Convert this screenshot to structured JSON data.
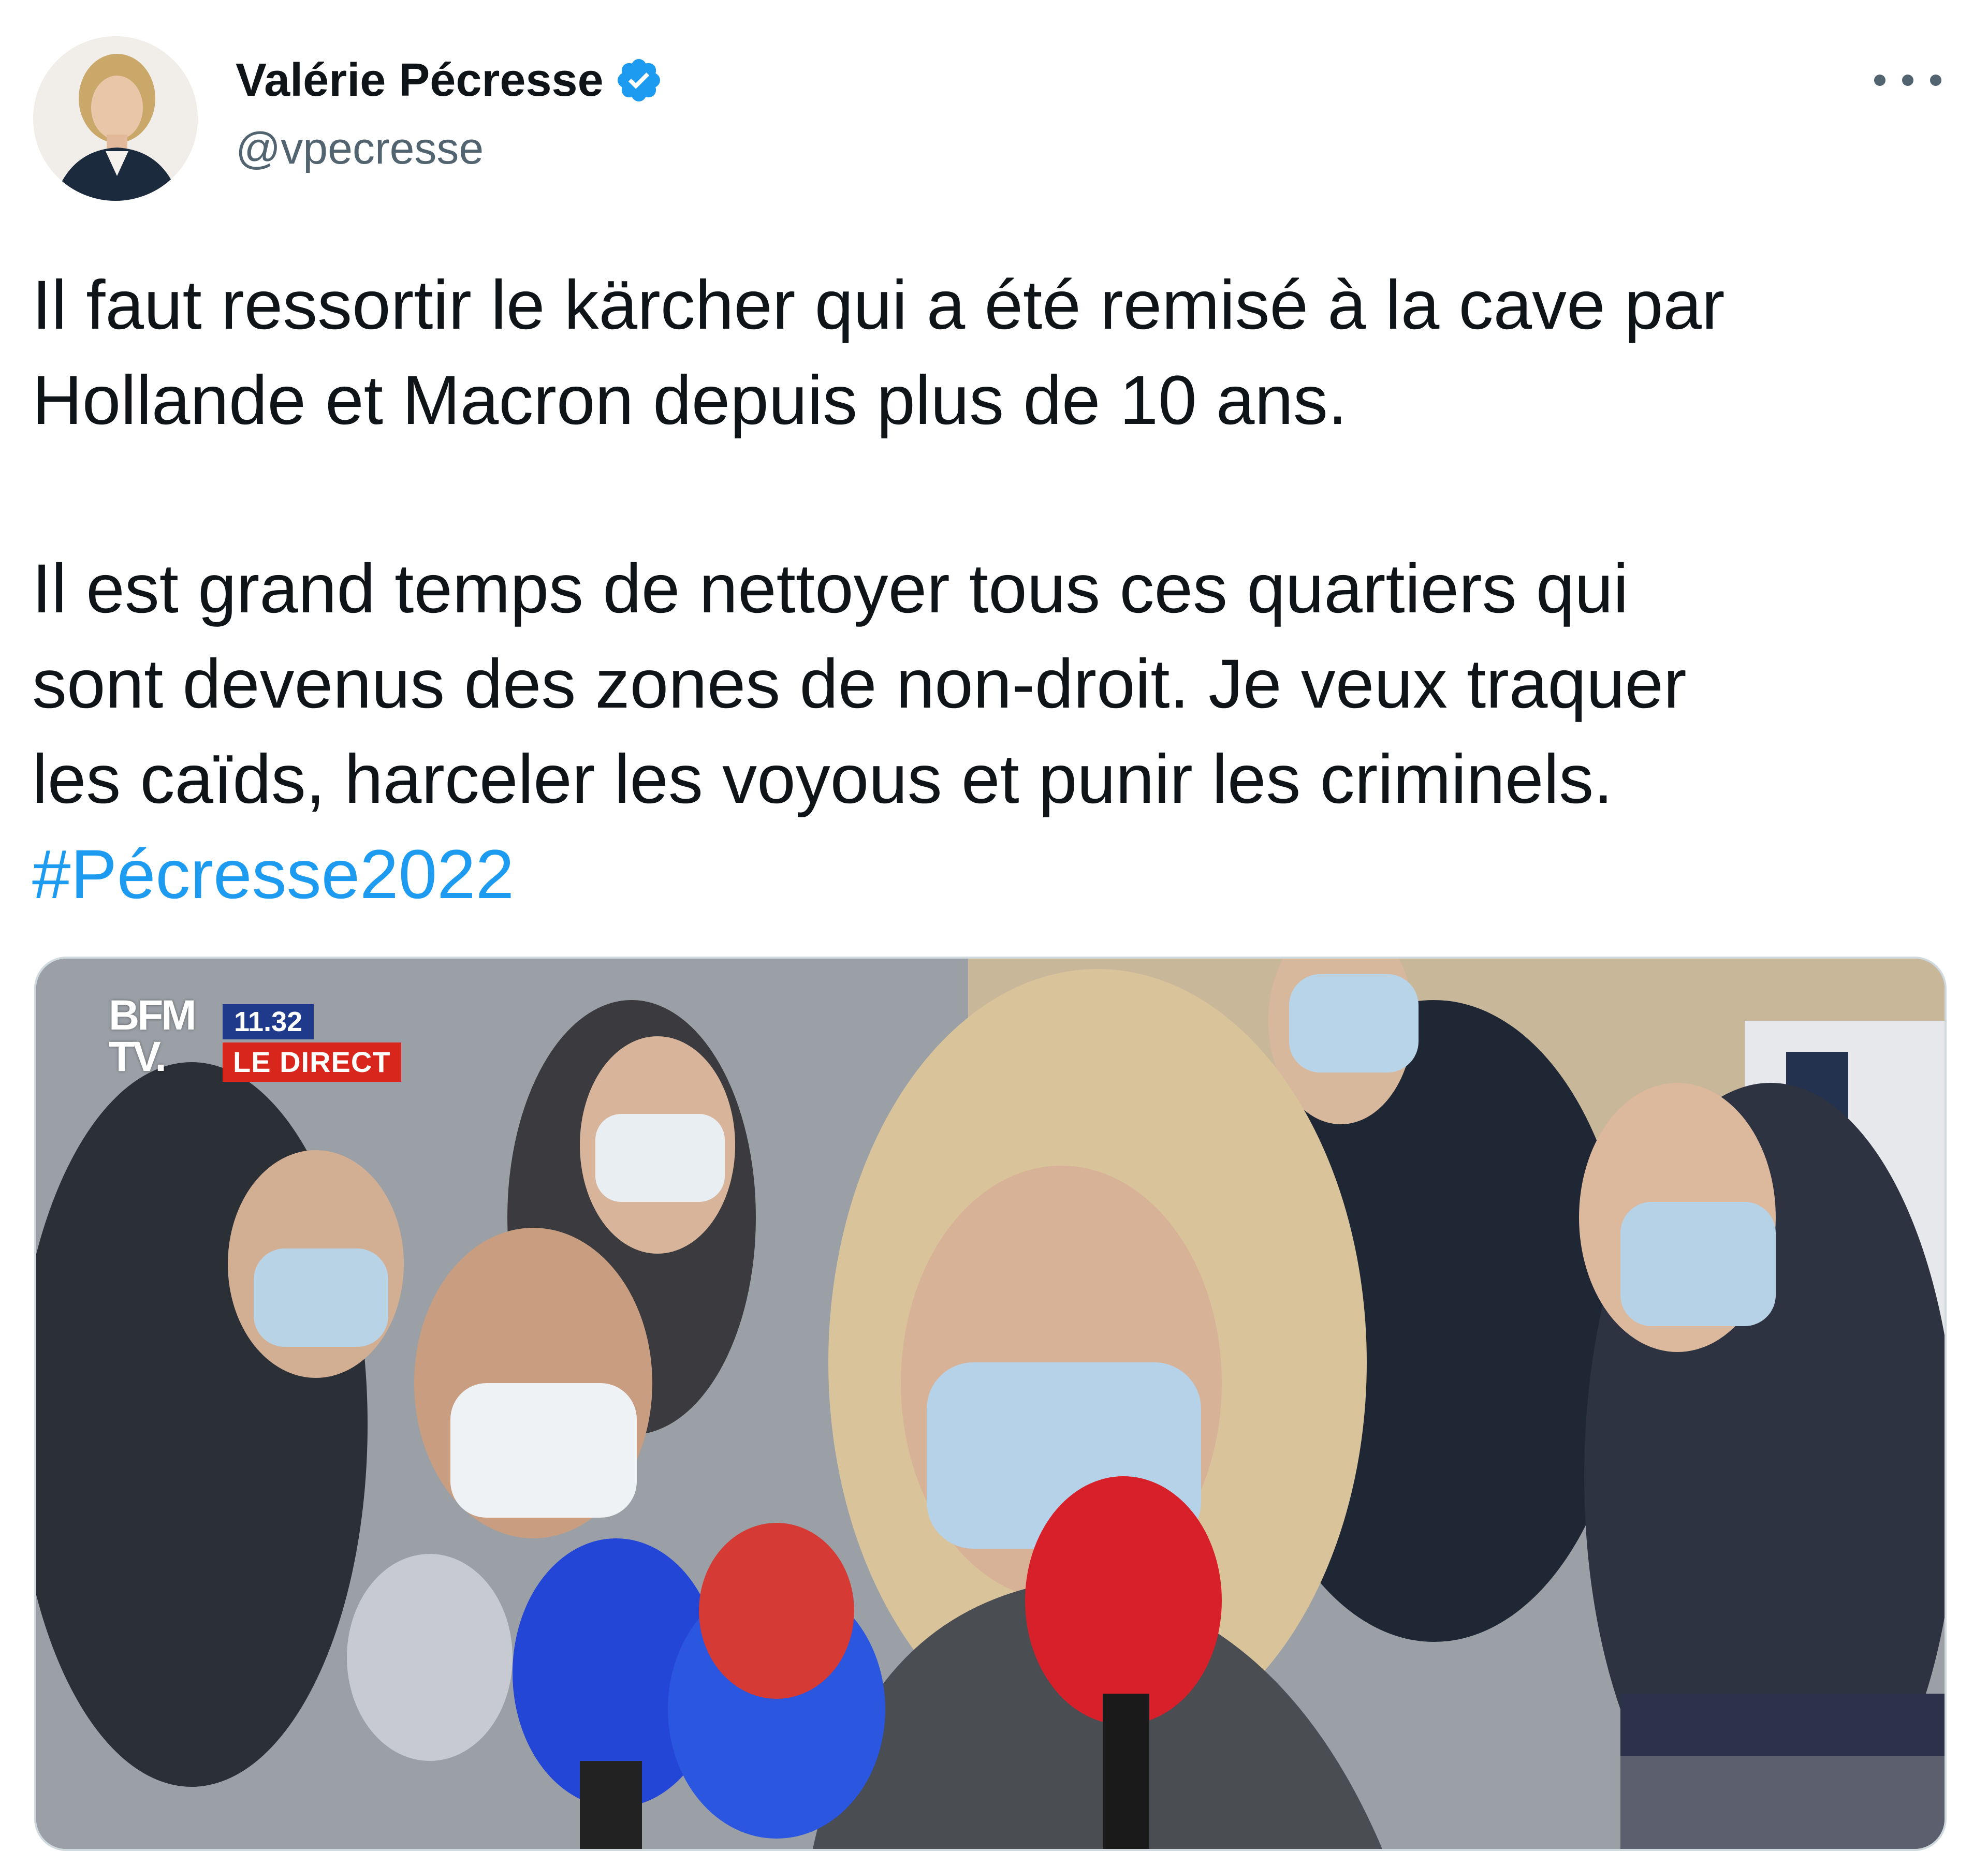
{
  "author": {
    "display_name": "Valérie Pécresse",
    "handle": "@vpecresse",
    "verified": true
  },
  "tweet": {
    "paragraph_1": "Il faut ressortir le kärcher qui a été remisé à la cave par\nHollande et Macron depuis plus de 10 ans.",
    "paragraph_2": "Il est grand temps de nettoyer tous ces quartiers qui\nsont devenus des zones de non-droit. Je veux traquer\nles caïds, harceler les voyous et punir les criminels.",
    "hashtag": "#Pécresse2022"
  },
  "media": {
    "type": "video",
    "overlay": {
      "channel": "BFM\nTV.",
      "time": "11.32",
      "live_label": "LE DIRECT"
    }
  },
  "colors": {
    "link": "#1d9bf0",
    "text": "#0f1419",
    "secondary": "#536471",
    "border": "#cfd9de",
    "verified": "#1d9bf0",
    "live_red": "#d9261c",
    "bfm_blue": "#1f3a8a"
  },
  "icons": {
    "more": "more-horizontal-icon",
    "verified": "verified-badge-icon"
  }
}
